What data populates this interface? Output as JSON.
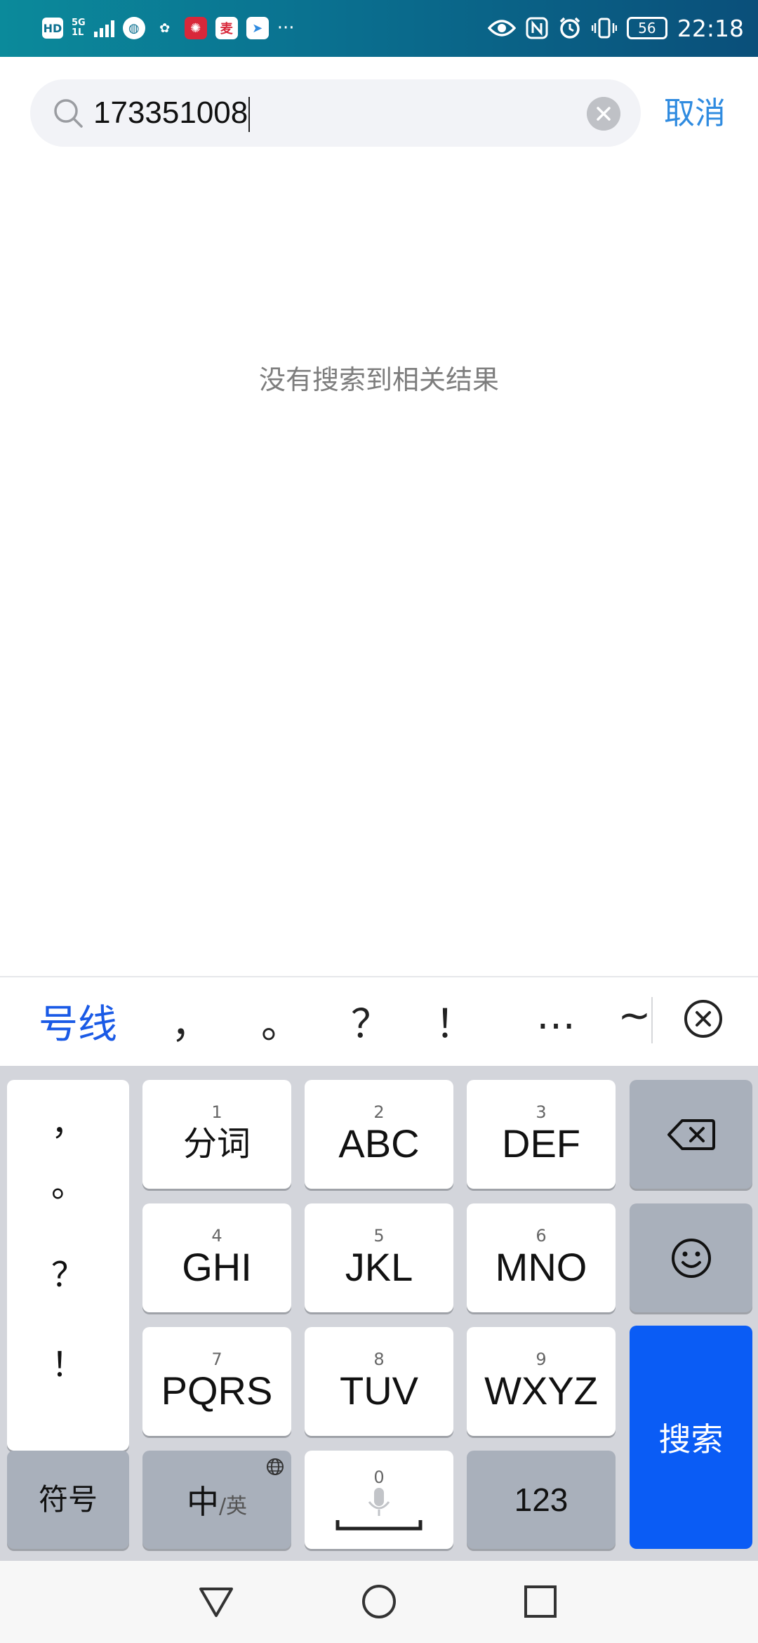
{
  "status_bar": {
    "hd_badge": "HD",
    "network_top": "5G",
    "network_bottom": "1L",
    "more": "···",
    "battery": "56",
    "time": "22:18"
  },
  "search": {
    "query": "173351008",
    "cancel_label": "取消"
  },
  "results": {
    "empty_message": "没有搜索到相关结果"
  },
  "candidate_bar": {
    "first": "号线",
    "punctuation": [
      "，",
      "。",
      "？",
      "！",
      "…",
      "~"
    ]
  },
  "keyboard": {
    "side_punctuation": [
      "，",
      "。",
      "？",
      "！"
    ],
    "keys": [
      {
        "num": "1",
        "label": "分词"
      },
      {
        "num": "2",
        "label": "ABC"
      },
      {
        "num": "3",
        "label": "DEF"
      },
      {
        "num": "4",
        "label": "GHI"
      },
      {
        "num": "5",
        "label": "JKL"
      },
      {
        "num": "6",
        "label": "MNO"
      },
      {
        "num": "7",
        "label": "PQRS"
      },
      {
        "num": "8",
        "label": "TUV"
      },
      {
        "num": "9",
        "label": "WXYZ"
      }
    ],
    "symbols_label": "符号",
    "lang_main": "中",
    "lang_alt": "/英",
    "space_num": "0",
    "numbers_label": "123",
    "search_label": "搜索"
  },
  "colors": {
    "accent_blue": "#2f8be0",
    "search_key": "#0a5cf5",
    "candidate_blue": "#1a5ae6"
  }
}
